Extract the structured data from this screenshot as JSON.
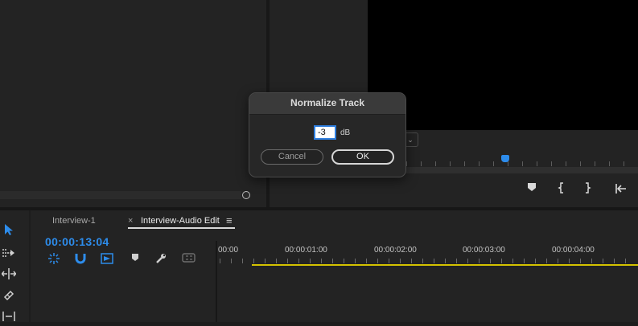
{
  "dialog": {
    "title": "Normalize Track",
    "db_value": "-3",
    "db_unit": "dB",
    "cancel_label": "Cancel",
    "ok_label": "OK"
  },
  "program_monitor": {
    "zoom_dropdown_icon": "chevron-down-icon",
    "controls": [
      "add-marker-icon",
      "mark-in-icon",
      "mark-out-icon",
      "go-to-in-icon"
    ]
  },
  "timeline": {
    "tabs": [
      {
        "label": "Interview-1",
        "active": false
      },
      {
        "label": "Interview-Audio Edit",
        "active": true
      }
    ],
    "tab_close_glyph": "×",
    "tab_menu_glyph": "≡",
    "timecode": "00:00:13:04",
    "ruler_labels": [
      "00:00",
      "00:00:01:00",
      "00:00:02:00",
      "00:00:03:00",
      "00:00:04:00"
    ],
    "tool_icons": [
      "nest-sequence-icon",
      "snap-magnet-icon",
      "linked-selection-icon",
      "add-marker-icon",
      "settings-wrench-icon",
      "captions-icon"
    ]
  },
  "tools": [
    "selection-tool-icon",
    "track-select-tool-icon",
    "ripple-edit-tool-icon",
    "razor-tool-icon",
    "slip-tool-icon"
  ],
  "colors": {
    "accent_blue": "#2d8ceb",
    "work_area_yellow": "#d4c200",
    "panel_bg": "#232323"
  }
}
